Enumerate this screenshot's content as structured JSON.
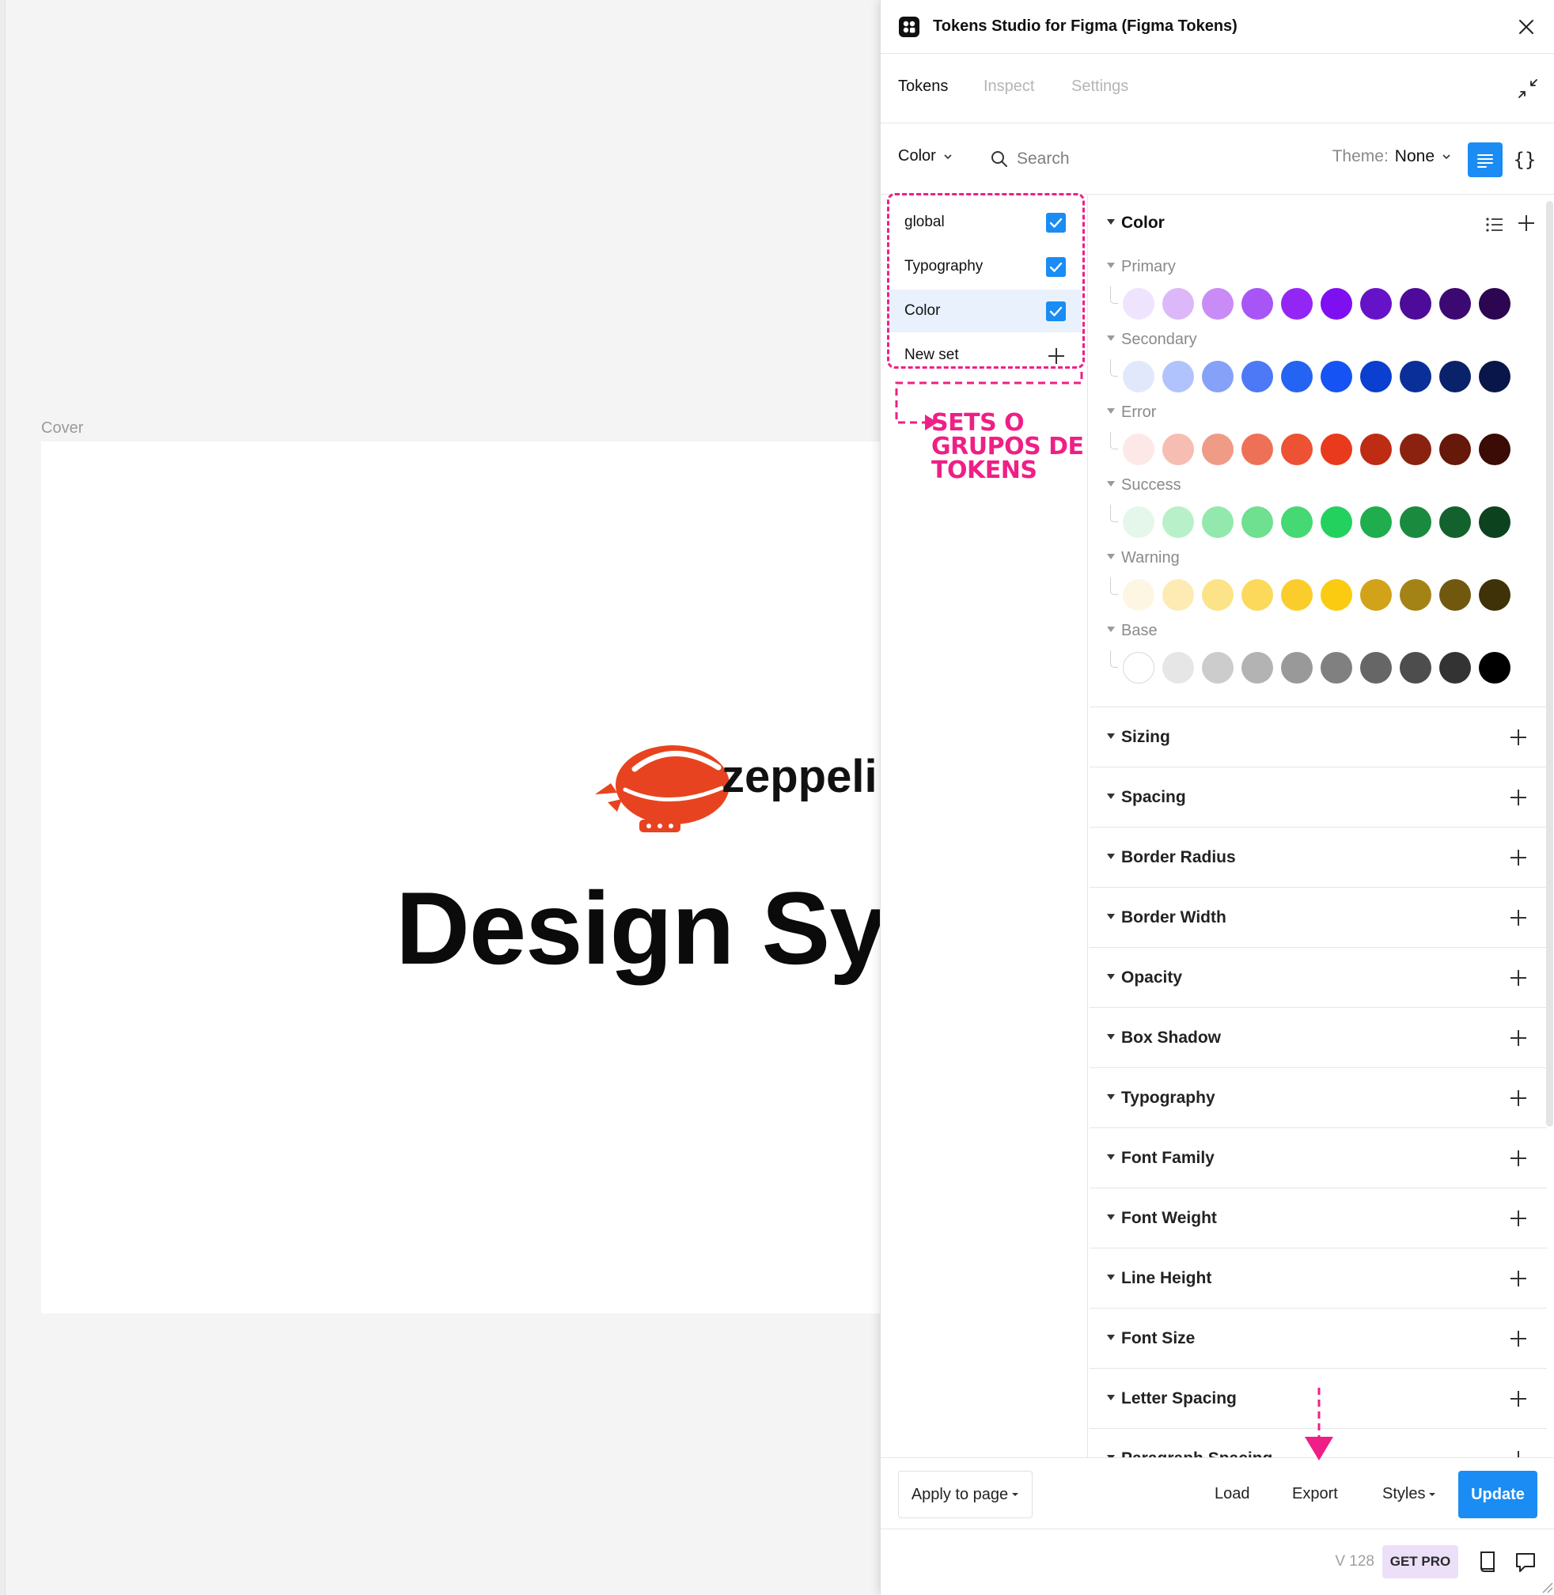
{
  "canvas": {
    "frame_label": "Cover",
    "brand_name": "zeppelin",
    "hero_title": "Design System"
  },
  "plugin": {
    "title": "Tokens Studio for Figma (Figma Tokens)",
    "tabs": [
      {
        "label": "Tokens",
        "active": true
      },
      {
        "label": "Inspect",
        "active": false
      },
      {
        "label": "Settings",
        "active": false
      }
    ],
    "toolbar": {
      "set_dropdown": "Color",
      "search_placeholder": "Search",
      "theme_label": "Theme:",
      "theme_value": "None"
    },
    "sets": [
      {
        "label": "global",
        "checked": true,
        "active": false
      },
      {
        "label": "Typography",
        "checked": true,
        "active": false
      },
      {
        "label": "Color",
        "checked": true,
        "active": true
      }
    ],
    "new_set_label": "New set",
    "annotations": {
      "sets": [
        "SETS O",
        "GRUPOS DE",
        "TOKENS"
      ]
    },
    "color_section": {
      "heading": "Color",
      "groups": [
        {
          "name": "Primary",
          "colors": [
            "#efe4fd",
            "#dcb8f8",
            "#c98bf6",
            "#a855f7",
            "#9426f5",
            "#7e0ff0",
            "#6612c9",
            "#4e0a99",
            "#3c0972",
            "#2c0650"
          ]
        },
        {
          "name": "Secondary",
          "colors": [
            "#e2e8fc",
            "#b1c3fc",
            "#85a2f8",
            "#4d79f6",
            "#2563f2",
            "#1553f4",
            "#0a3fcf",
            "#0b2f98",
            "#0a226a",
            "#081649"
          ]
        },
        {
          "name": "Error",
          "colors": [
            "#fde8e8",
            "#f6bdb2",
            "#f09b85",
            "#ee7157",
            "#ec5233",
            "#e93a1d",
            "#bd2c13",
            "#8b2210",
            "#66180a",
            "#3a0c05"
          ]
        },
        {
          "name": "Success",
          "colors": [
            "#e4f7ea",
            "#b8f0ca",
            "#93e9ad",
            "#6fdf90",
            "#45d873",
            "#23d25e",
            "#1fad4d",
            "#1a8a3f",
            "#13622d",
            "#0c421e"
          ]
        },
        {
          "name": "Warning",
          "colors": [
            "#fdf6e3",
            "#fdebb3",
            "#fde387",
            "#fcd95a",
            "#fbcd2c",
            "#facb10",
            "#d2a219",
            "#a48316",
            "#71580f",
            "#3f3208"
          ]
        },
        {
          "name": "Base",
          "colors": [
            "#ffffff",
            "#e6e6e6",
            "#cccccc",
            "#b3b3b3",
            "#999999",
            "#808080",
            "#666666",
            "#4d4d4d",
            "#333333",
            "#000000"
          ]
        }
      ]
    },
    "categories": [
      "Sizing",
      "Spacing",
      "Border Radius",
      "Border Width",
      "Opacity",
      "Box Shadow",
      "Typography",
      "Font Family",
      "Font Weight",
      "Line Height",
      "Font Size",
      "Letter Spacing",
      "Paragraph Spacing"
    ],
    "footer": {
      "apply_label": "Apply to page",
      "load_label": "Load",
      "export_label": "Export",
      "styles_label": "Styles",
      "update_label": "Update"
    },
    "status": {
      "version": "V 128",
      "get_pro": "GET PRO"
    }
  }
}
